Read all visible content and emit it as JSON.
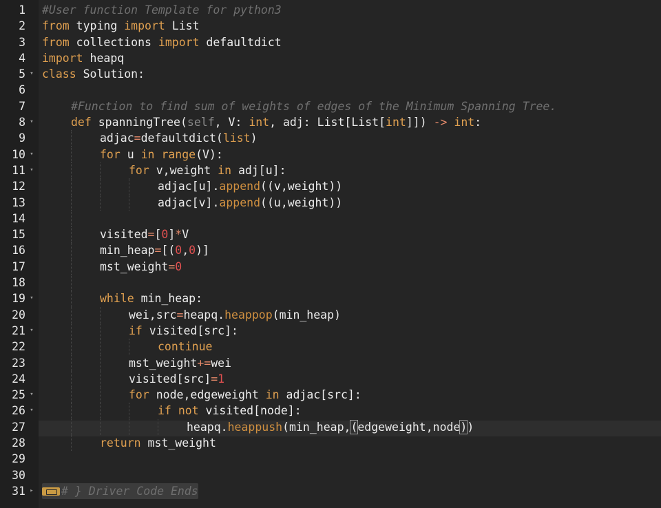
{
  "editor": {
    "language": "python3",
    "active_line": 27,
    "lines": [
      {
        "n": "1",
        "fold": false,
        "indent": 0,
        "tokens": [
          {
            "t": "#User function Template for python3",
            "c": "comment"
          }
        ]
      },
      {
        "n": "2",
        "fold": false,
        "indent": 0,
        "tokens": [
          {
            "t": "from",
            "c": "kw"
          },
          {
            "t": " typing ",
            "c": "plain"
          },
          {
            "t": "import",
            "c": "kw"
          },
          {
            "t": " List",
            "c": "plain"
          }
        ]
      },
      {
        "n": "3",
        "fold": false,
        "indent": 0,
        "tokens": [
          {
            "t": "from",
            "c": "kw"
          },
          {
            "t": " collections ",
            "c": "plain"
          },
          {
            "t": "import",
            "c": "kw"
          },
          {
            "t": " defaultdict",
            "c": "plain"
          }
        ]
      },
      {
        "n": "4",
        "fold": false,
        "indent": 0,
        "tokens": [
          {
            "t": "import",
            "c": "kw"
          },
          {
            "t": " heapq",
            "c": "plain"
          }
        ]
      },
      {
        "n": "5",
        "fold": true,
        "indent": 0,
        "tokens": [
          {
            "t": "class",
            "c": "kw"
          },
          {
            "t": " Solution:",
            "c": "plain"
          }
        ]
      },
      {
        "n": "6",
        "fold": false,
        "indent": 0,
        "tokens": []
      },
      {
        "n": "7",
        "fold": false,
        "indent": 1,
        "tokens": [
          {
            "t": "#Function to find sum of weights of edges of the Minimum Spanning Tree.",
            "c": "comment"
          }
        ]
      },
      {
        "n": "8",
        "fold": true,
        "indent": 1,
        "tokens": [
          {
            "t": "def",
            "c": "kw"
          },
          {
            "t": " spanningTree(",
            "c": "plain"
          },
          {
            "t": "self",
            "c": "self"
          },
          {
            "t": ", V: ",
            "c": "plain"
          },
          {
            "t": "int",
            "c": "kw"
          },
          {
            "t": ", adj: List[List[",
            "c": "plain"
          },
          {
            "t": "int",
            "c": "kw"
          },
          {
            "t": "]]) ",
            "c": "plain"
          },
          {
            "t": "->",
            "c": "op"
          },
          {
            "t": " ",
            "c": "plain"
          },
          {
            "t": "int",
            "c": "kw"
          },
          {
            "t": ":",
            "c": "plain"
          }
        ]
      },
      {
        "n": "9",
        "fold": false,
        "indent": 2,
        "tokens": [
          {
            "t": "adjac",
            "c": "plain"
          },
          {
            "t": "=",
            "c": "op"
          },
          {
            "t": "defaultdict(",
            "c": "plain"
          },
          {
            "t": "list",
            "c": "kw"
          },
          {
            "t": ")",
            "c": "plain"
          }
        ]
      },
      {
        "n": "10",
        "fold": true,
        "indent": 2,
        "tokens": [
          {
            "t": "for",
            "c": "kw"
          },
          {
            "t": " u ",
            "c": "plain"
          },
          {
            "t": "in",
            "c": "kw"
          },
          {
            "t": " ",
            "c": "plain"
          },
          {
            "t": "range",
            "c": "kw"
          },
          {
            "t": "(V):",
            "c": "plain"
          }
        ]
      },
      {
        "n": "11",
        "fold": true,
        "indent": 3,
        "tokens": [
          {
            "t": "for",
            "c": "kw"
          },
          {
            "t": " v,weight ",
            "c": "plain"
          },
          {
            "t": "in",
            "c": "kw"
          },
          {
            "t": " adj[u]:",
            "c": "plain"
          }
        ]
      },
      {
        "n": "12",
        "fold": false,
        "indent": 4,
        "tokens": [
          {
            "t": "adjac[u].",
            "c": "plain"
          },
          {
            "t": "append",
            "c": "fn"
          },
          {
            "t": "((v,weight))",
            "c": "plain"
          }
        ]
      },
      {
        "n": "13",
        "fold": false,
        "indent": 4,
        "tokens": [
          {
            "t": "adjac[v].",
            "c": "plain"
          },
          {
            "t": "append",
            "c": "fn"
          },
          {
            "t": "((u,weight))",
            "c": "plain"
          }
        ]
      },
      {
        "n": "14",
        "fold": false,
        "indent": 2,
        "tokens": []
      },
      {
        "n": "15",
        "fold": false,
        "indent": 2,
        "tokens": [
          {
            "t": "visited",
            "c": "plain"
          },
          {
            "t": "=",
            "c": "op"
          },
          {
            "t": "[",
            "c": "plain"
          },
          {
            "t": "0",
            "c": "num"
          },
          {
            "t": "]",
            "c": "plain"
          },
          {
            "t": "*",
            "c": "op"
          },
          {
            "t": "V",
            "c": "plain"
          }
        ]
      },
      {
        "n": "16",
        "fold": false,
        "indent": 2,
        "tokens": [
          {
            "t": "min_heap",
            "c": "plain"
          },
          {
            "t": "=",
            "c": "op"
          },
          {
            "t": "[(",
            "c": "plain"
          },
          {
            "t": "0",
            "c": "num"
          },
          {
            "t": ",",
            "c": "plain"
          },
          {
            "t": "0",
            "c": "num"
          },
          {
            "t": ")]",
            "c": "plain"
          }
        ]
      },
      {
        "n": "17",
        "fold": false,
        "indent": 2,
        "tokens": [
          {
            "t": "mst_weight",
            "c": "plain"
          },
          {
            "t": "=",
            "c": "op"
          },
          {
            "t": "0",
            "c": "num"
          }
        ]
      },
      {
        "n": "18",
        "fold": false,
        "indent": 2,
        "tokens": []
      },
      {
        "n": "19",
        "fold": true,
        "indent": 2,
        "tokens": [
          {
            "t": "while",
            "c": "kw"
          },
          {
            "t": " min_heap:",
            "c": "plain"
          }
        ]
      },
      {
        "n": "20",
        "fold": false,
        "indent": 3,
        "tokens": [
          {
            "t": "wei,src",
            "c": "plain"
          },
          {
            "t": "=",
            "c": "op"
          },
          {
            "t": "heapq.",
            "c": "plain"
          },
          {
            "t": "heappop",
            "c": "fn"
          },
          {
            "t": "(min_heap)",
            "c": "plain"
          }
        ]
      },
      {
        "n": "21",
        "fold": true,
        "indent": 3,
        "tokens": [
          {
            "t": "if",
            "c": "kw"
          },
          {
            "t": " visited[src]:",
            "c": "plain"
          }
        ]
      },
      {
        "n": "22",
        "fold": false,
        "indent": 4,
        "tokens": [
          {
            "t": "continue",
            "c": "kw"
          }
        ]
      },
      {
        "n": "23",
        "fold": false,
        "indent": 3,
        "tokens": [
          {
            "t": "mst_weight",
            "c": "plain"
          },
          {
            "t": "+=",
            "c": "op"
          },
          {
            "t": "wei",
            "c": "plain"
          }
        ]
      },
      {
        "n": "24",
        "fold": false,
        "indent": 3,
        "tokens": [
          {
            "t": "visited[src]",
            "c": "plain"
          },
          {
            "t": "=",
            "c": "op"
          },
          {
            "t": "1",
            "c": "num"
          }
        ]
      },
      {
        "n": "25",
        "fold": true,
        "indent": 3,
        "tokens": [
          {
            "t": "for",
            "c": "kw"
          },
          {
            "t": " node,edgeweight ",
            "c": "plain"
          },
          {
            "t": "in",
            "c": "kw"
          },
          {
            "t": " adjac[src]:",
            "c": "plain"
          }
        ]
      },
      {
        "n": "26",
        "fold": true,
        "indent": 4,
        "tokens": [
          {
            "t": "if",
            "c": "kw"
          },
          {
            "t": " ",
            "c": "plain"
          },
          {
            "t": "not",
            "c": "kw"
          },
          {
            "t": " visited[node]:",
            "c": "plain"
          }
        ]
      },
      {
        "n": "27",
        "fold": false,
        "indent": 5,
        "tokens": [
          {
            "t": "heapq.",
            "c": "plain"
          },
          {
            "t": "heappush",
            "c": "fn"
          },
          {
            "t": "(min_heap,",
            "c": "plain"
          },
          {
            "t": "(",
            "c": "brace"
          },
          {
            "t": "edgeweight,node",
            "c": "plain"
          },
          {
            "t": ")",
            "c": "brace"
          },
          {
            "t": ")",
            "c": "plain"
          }
        ]
      },
      {
        "n": "28",
        "fold": false,
        "indent": 2,
        "tokens": [
          {
            "t": "return",
            "c": "kw"
          },
          {
            "t": " mst_weight",
            "c": "plain"
          }
        ]
      },
      {
        "n": "29",
        "fold": false,
        "indent": 0,
        "tokens": []
      },
      {
        "n": "30",
        "fold": false,
        "indent": 0,
        "tokens": []
      },
      {
        "n": "31",
        "fold": "collapsed",
        "indent": 0,
        "tokens": [
          {
            "t": "# } Driver Code Ends",
            "c": "foldwidget"
          }
        ]
      }
    ]
  },
  "colors": {
    "background": "#252525",
    "gutter": "#1f1f1f",
    "keyword": "#e0a050",
    "number": "#e05050",
    "comment": "#6f6f6f",
    "text": "#ececec"
  }
}
